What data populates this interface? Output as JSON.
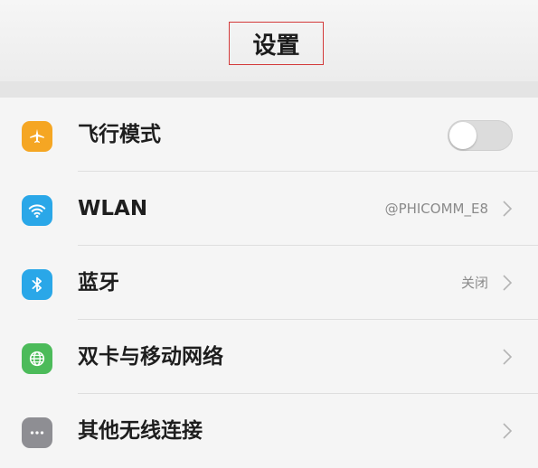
{
  "header": {
    "title": "设置"
  },
  "settings": {
    "items": [
      {
        "label": "飞行模式",
        "icon": "airplane-icon",
        "icon_color": "#f5a623",
        "control": "toggle",
        "toggle_on": false
      },
      {
        "label": "WLAN",
        "icon": "wifi-icon",
        "icon_color": "#2aa7e8",
        "value": "@PHICOMM_E8",
        "control": "chevron"
      },
      {
        "label": "蓝牙",
        "icon": "bluetooth-icon",
        "icon_color": "#2aa7e8",
        "value": "关闭",
        "control": "chevron"
      },
      {
        "label": "双卡与移动网络",
        "icon": "globe-icon",
        "icon_color": "#4cbb5a",
        "control": "chevron"
      },
      {
        "label": "其他无线连接",
        "icon": "more-icon",
        "icon_color": "#8e8e93",
        "control": "chevron"
      }
    ]
  },
  "colors": {
    "background": "#f5f5f5",
    "highlight_border": "#d33a3a",
    "text": "#1e1e1e",
    "secondary_text": "#8a8a8a"
  }
}
